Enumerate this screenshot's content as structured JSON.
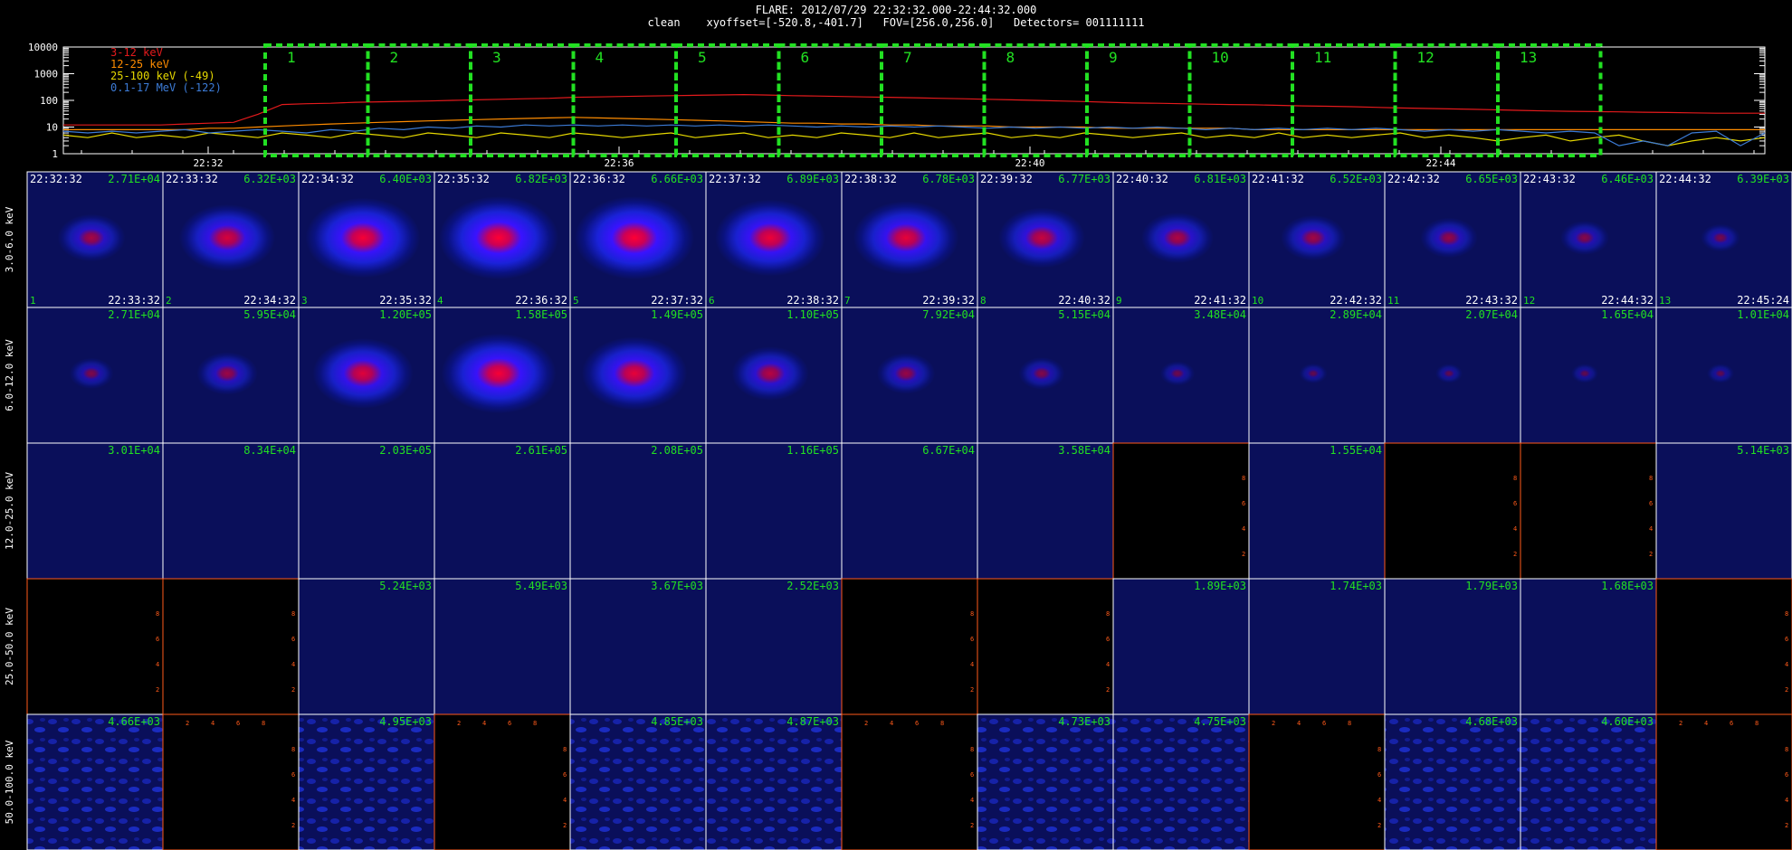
{
  "header": {
    "line1": "FLARE: 2012/07/29 22:32:32.000-22:44:32.000",
    "line2": "clean    xyoffset=[-520.8,-401.7]   FOV=[256.0,256.0]   Detectors= 001111111"
  },
  "chart_data": [
    {
      "type": "line",
      "ylog": true,
      "ylim": [
        1,
        10000
      ],
      "yticks": [
        "10000",
        "1000",
        "100",
        "10",
        "1"
      ],
      "xticks": [
        "22:32",
        "22:36",
        "22:40",
        "22:44"
      ],
      "series": [
        {
          "name": "3-12 keV",
          "color": "#e41a1c",
          "values": [
            12,
            12,
            12,
            12,
            12,
            13,
            14,
            15,
            30,
            70,
            75,
            78,
            85,
            88,
            92,
            95,
            100,
            105,
            110,
            115,
            120,
            130,
            135,
            140,
            145,
            150,
            155,
            160,
            165,
            158,
            150,
            145,
            140,
            135,
            130,
            125,
            120,
            115,
            110,
            105,
            100,
            95,
            90,
            85,
            80,
            78,
            75,
            72,
            70,
            68,
            65,
            62,
            60,
            58,
            55,
            52,
            50,
            48,
            46,
            44,
            42,
            40,
            39,
            38,
            37,
            36,
            35,
            34,
            33,
            33,
            33
          ]
        },
        {
          "name": "12-25 keV",
          "color": "#ff8c00",
          "values": [
            8,
            8,
            8,
            8,
            8,
            8,
            9,
            9,
            10,
            11,
            12,
            13,
            14,
            15,
            16,
            17,
            18,
            19,
            20,
            21,
            22,
            23,
            22,
            21,
            20,
            19,
            18,
            17,
            16,
            15,
            14,
            14,
            13,
            13,
            12,
            12,
            11,
            11,
            11,
            10,
            10,
            10,
            10,
            9,
            9,
            9,
            9,
            9,
            9,
            8,
            8,
            8,
            8,
            8,
            8,
            8,
            8,
            8,
            8,
            8,
            8,
            8,
            8,
            8,
            8,
            8,
            8,
            8,
            8,
            8,
            8
          ]
        },
        {
          "name": "25-100 keV (-49)",
          "color": "#e6d800",
          "values": [
            5,
            4,
            6,
            4,
            5,
            4,
            6,
            5,
            4,
            6,
            5,
            4,
            6,
            5,
            4,
            6,
            5,
            4,
            6,
            5,
            4,
            6,
            5,
            4,
            5,
            6,
            4,
            5,
            6,
            4,
            5,
            4,
            6,
            5,
            4,
            6,
            4,
            5,
            6,
            4,
            5,
            4,
            6,
            5,
            4,
            5,
            6,
            4,
            5,
            4,
            6,
            4,
            5,
            4,
            5,
            6,
            4,
            5,
            4,
            3,
            4,
            5,
            3,
            4,
            5,
            3,
            2,
            3,
            4,
            3,
            4
          ]
        },
        {
          "name": "0.1-17 MeV (-122)",
          "color": "#3c7bd6",
          "values": [
            7,
            6,
            7,
            6,
            7,
            8,
            6,
            7,
            8,
            7,
            6,
            8,
            7,
            9,
            8,
            10,
            9,
            11,
            10,
            12,
            11,
            12,
            11,
            12,
            11,
            12,
            11,
            12,
            11,
            12,
            11,
            10,
            11,
            10,
            11,
            10,
            11,
            10,
            9,
            10,
            9,
            10,
            9,
            10,
            9,
            10,
            9,
            8,
            9,
            8,
            9,
            8,
            9,
            8,
            9,
            8,
            7,
            8,
            7,
            8,
            7,
            6,
            7,
            6,
            2,
            3,
            2,
            6,
            7,
            2,
            6
          ]
        }
      ],
      "intervals": [
        "1",
        "2",
        "3",
        "4",
        "5",
        "6",
        "7",
        "8",
        "9",
        "10",
        "11",
        "12",
        "13"
      ]
    },
    {
      "type": "heatmap",
      "rows": [
        "3.0-6.0 keV",
        "6.0-12.0 keV",
        "12.0-25.0 keV",
        "25.0-50.0 keV",
        "50.0-100.0 keV"
      ],
      "start_times": [
        "22:32:32",
        "22:33:32",
        "22:34:32",
        "22:35:32",
        "22:36:32",
        "22:37:32",
        "22:38:32",
        "22:39:32",
        "22:40:32",
        "22:41:32",
        "22:42:32",
        "22:43:32",
        "22:44:32"
      ],
      "end_times": [
        "22:33:32",
        "22:34:32",
        "22:35:32",
        "22:36:32",
        "22:37:32",
        "22:38:32",
        "22:39:32",
        "22:40:32",
        "22:41:32",
        "22:42:32",
        "22:43:32",
        "22:44:32",
        "22:45:24"
      ],
      "cells": [
        [
          {
            "max": "2.71E+04",
            "i": 0.45
          },
          {
            "max": "6.32E+03",
            "i": 0.75
          },
          {
            "max": "6.40E+03",
            "i": 0.95
          },
          {
            "max": "6.82E+03",
            "i": 1.0
          },
          {
            "max": "6.66E+03",
            "i": 1.0
          },
          {
            "max": "6.89E+03",
            "i": 0.9
          },
          {
            "max": "6.78E+03",
            "i": 0.85
          },
          {
            "max": "6.77E+03",
            "i": 0.65
          },
          {
            "max": "6.81E+03",
            "i": 0.5
          },
          {
            "max": "6.52E+03",
            "i": 0.42
          },
          {
            "max": "6.65E+03",
            "i": 0.34
          },
          {
            "max": "6.46E+03",
            "i": 0.25
          },
          {
            "max": "6.39E+03",
            "i": 0.15
          }
        ],
        [
          {
            "max": "2.71E+04",
            "i": 0.2
          },
          {
            "max": "5.95E+04",
            "i": 0.38
          },
          {
            "max": "1.20E+05",
            "i": 0.8
          },
          {
            "max": "1.58E+05",
            "i": 0.95
          },
          {
            "max": "1.49E+05",
            "i": 0.85
          },
          {
            "max": "1.10E+05",
            "i": 0.55
          },
          {
            "max": "7.92E+04",
            "i": 0.35
          },
          {
            "max": "5.15E+04",
            "i": 0.22
          },
          {
            "max": "3.48E+04",
            "i": 0.1
          },
          {
            "max": "2.89E+04",
            "i": 0.03
          },
          {
            "max": "2.07E+04",
            "i": 0.02
          },
          {
            "max": "1.65E+04",
            "i": 0.02
          },
          {
            "max": "1.01E+04",
            "i": 0.02
          }
        ],
        [
          {
            "max": "3.01E+04",
            "i": 0
          },
          {
            "max": "8.34E+04",
            "i": 0
          },
          {
            "max": "2.03E+05",
            "i": 0
          },
          {
            "max": "2.61E+05",
            "i": 0
          },
          {
            "max": "2.08E+05",
            "i": 0
          },
          {
            "max": "1.16E+05",
            "i": 0
          },
          {
            "max": "6.67E+04",
            "i": 0
          },
          {
            "max": "3.58E+04",
            "i": 0
          },
          {
            "empty": true
          },
          {
            "max": "1.55E+04",
            "i": 0
          },
          {
            "empty": true
          },
          {
            "empty": true
          },
          {
            "max": "5.14E+03",
            "i": 0
          }
        ],
        [
          {
            "empty": true
          },
          {
            "empty": true
          },
          {
            "max": "5.24E+03",
            "i": 0
          },
          {
            "max": "5.49E+03",
            "i": 0
          },
          {
            "max": "3.67E+03",
            "i": 0
          },
          {
            "max": "2.52E+03",
            "i": 0
          },
          {
            "empty": true
          },
          {
            "empty": true
          },
          {
            "max": "1.89E+03",
            "i": 0
          },
          {
            "max": "1.74E+03",
            "i": 0
          },
          {
            "max": "1.79E+03",
            "i": 0
          },
          {
            "max": "1.68E+03",
            "i": 0
          },
          {
            "empty": true
          }
        ],
        [
          {
            "max": "4.66E+03",
            "i": -1
          },
          {
            "empty": true
          },
          {
            "max": "4.95E+03",
            "i": -1
          },
          {
            "empty": true
          },
          {
            "max": "4.85E+03",
            "i": -1
          },
          {
            "max": "4.87E+03",
            "i": -1
          },
          {
            "empty": true
          },
          {
            "max": "4.73E+03",
            "i": -1
          },
          {
            "max": "4.75E+03",
            "i": -1
          },
          {
            "empty": true
          },
          {
            "max": "4.68E+03",
            "i": -1
          },
          {
            "max": "4.60E+03",
            "i": -1
          },
          {
            "empty": true
          }
        ]
      ],
      "empty_axis_ticks": [
        "2",
        "4",
        "6",
        "8"
      ]
    }
  ]
}
